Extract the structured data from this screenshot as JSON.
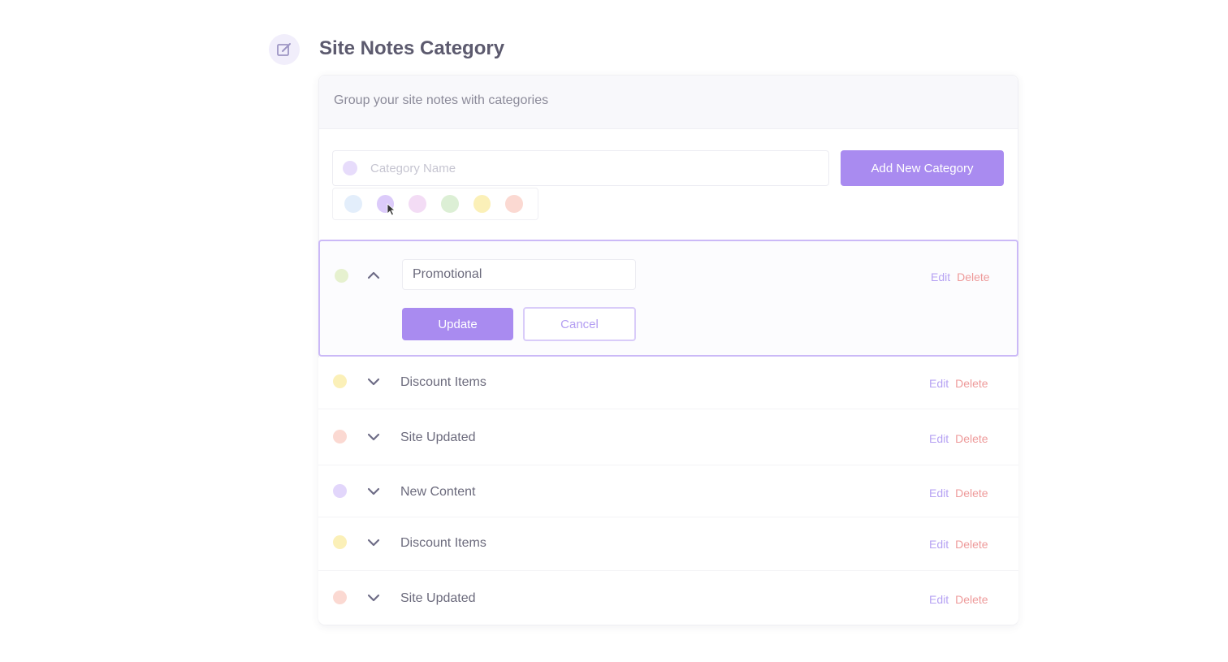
{
  "header": {
    "title": "Site Notes Category",
    "icon": "edit-icon"
  },
  "card": {
    "description": "Group your site notes with categories"
  },
  "form": {
    "name_placeholder": "Category Name",
    "name_value": "",
    "add_button_label": "Add New Category",
    "swatches": [
      "#e3eefb",
      "#dccbfa",
      "#f3dcf5",
      "#dcefd5",
      "#fbf0b8",
      "#fbd9d2"
    ]
  },
  "colors": {
    "accent": "#a98bf0",
    "danger": "#ee9a9a"
  },
  "active_row": {
    "dot_color": "#e6f1cf",
    "input_value": "Promotional",
    "update_label": "Update",
    "cancel_label": "Cancel",
    "edit_label": "Edit",
    "delete_label": "Delete"
  },
  "rows": [
    {
      "label": "Discount Items",
      "dot_color": "#fbf0b8",
      "edit": "Edit",
      "delete": "Delete"
    },
    {
      "label": "Site Updated",
      "dot_color": "#fbd9d2",
      "edit": "Edit",
      "delete": "Delete"
    },
    {
      "label": "New Content",
      "dot_color": "#e2d6fb",
      "edit": "Edit",
      "delete": "Delete"
    },
    {
      "label": "Discount Items",
      "dot_color": "#fbf0b8",
      "edit": "Edit",
      "delete": "Delete"
    },
    {
      "label": "Site Updated",
      "dot_color": "#fbd9d2",
      "edit": "Edit",
      "delete": "Delete"
    }
  ]
}
